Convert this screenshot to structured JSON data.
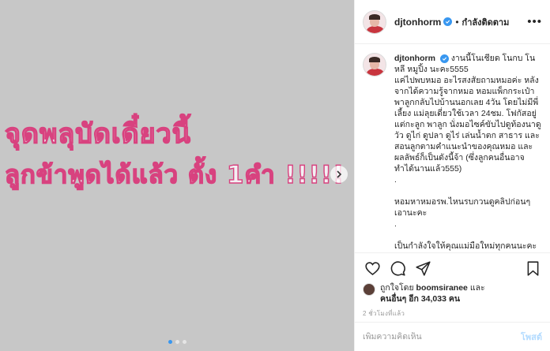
{
  "media": {
    "handwriting_line1": "จุดพลุบัดเดี๋ยวนี้",
    "handwriting_line2": "ลูกข้าพูดได้แล้ว ตั้ง 1คำ !!!!!",
    "carousel_dots": 3,
    "carousel_active": 0
  },
  "header": {
    "username": "djtonhorm",
    "separator": "•",
    "follow_status": "กำลังติดตาม",
    "more": "•••"
  },
  "caption": {
    "username": "djtonhorm",
    "line1": "งานนี้โนเชียด โนกบ โนหลี หมูปิ้ง นะคะ5555",
    "line2": "แค่ไปพบหมอ อะไรสงสัยถามหมอค่ะ หลังจากได้ความรู้จากหมอ หอมแพ็กกระเป๋าพาลูกกลับไปบ้านนอกเลย 4วัน โดยไม่มีพี่เลี้ยง แม่ลุยเดี่ยวใช้เวลา 24ชม. โฟกัสอยู่แต่กะลูก พาลูก นั่งมอไซค์ขับไปดูท้องนาดูวัว ดูไก่ ดูปลา ดูไร่ เล่นน้ำตก สาธาร และสอนลูกตามคำแนะนำของคุณหมอ และผลลัพธ์ก็เป็นดังนี้จ้า (ซึ่งลูกคนอื่นอาจทำได้นานแล้ว555)",
    "dot1": ".",
    "line3": "หอมหาหมอรพ.ไหนรบกวนดูคลิปก่อนๆเอานะคะ",
    "dot2": ".",
    "line4": "เป็นกำลังใจให้คุณแม่มือใหม่ทุกคนนะคะ"
  },
  "likes": {
    "prefix": "ถูกใจโดย",
    "user": "boomsiranee",
    "and": "และ",
    "others": "คนอื่นๆ อีก 34,033 คน"
  },
  "timestamp": "2 ชั่วโมงที่แล้ว",
  "comment_box": {
    "placeholder": "เพิ่มความคิดเห็น",
    "post_label": "โพสต์"
  },
  "colors": {
    "handwriting": "#d8427f",
    "verified": "#3897f0",
    "media_bg": "#c7c7c7"
  }
}
